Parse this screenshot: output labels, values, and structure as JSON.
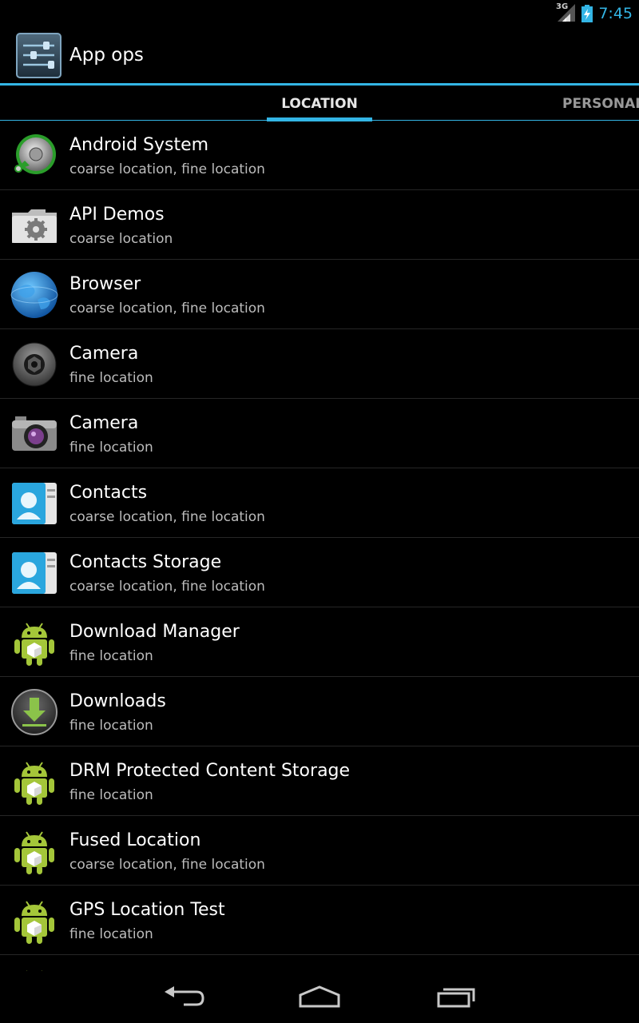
{
  "status_bar": {
    "network_label": "3G",
    "time": "7:45"
  },
  "action_bar": {
    "title": "App ops"
  },
  "tabs": [
    {
      "label": "LOCATION",
      "selected": true
    },
    {
      "label": "PERSONAL",
      "selected": false
    }
  ],
  "apps": [
    {
      "name": "Android System",
      "ops": "coarse location, fine location",
      "icon": "android-system-icon"
    },
    {
      "name": "API Demos",
      "ops": "coarse location",
      "icon": "folder-gear-icon"
    },
    {
      "name": "Browser",
      "ops": "coarse location, fine location",
      "icon": "globe-icon"
    },
    {
      "name": "Camera",
      "ops": "fine location",
      "icon": "camera-lens-icon"
    },
    {
      "name": "Camera",
      "ops": "fine location",
      "icon": "camera-icon"
    },
    {
      "name": "Contacts",
      "ops": "coarse location, fine location",
      "icon": "contacts-icon"
    },
    {
      "name": "Contacts Storage",
      "ops": "coarse location, fine location",
      "icon": "contacts-icon"
    },
    {
      "name": "Download Manager",
      "ops": "fine location",
      "icon": "android-robot-icon"
    },
    {
      "name": "Downloads",
      "ops": "fine location",
      "icon": "download-arrow-icon"
    },
    {
      "name": "DRM Protected Content Storage",
      "ops": "fine location",
      "icon": "android-robot-icon"
    },
    {
      "name": "Fused Location",
      "ops": "coarse location, fine location",
      "icon": "android-robot-icon"
    },
    {
      "name": "GPS Location Test",
      "ops": "fine location",
      "icon": "android-robot-icon"
    },
    {
      "name": "",
      "ops": "",
      "icon": "android-robot-icon"
    }
  ],
  "colors": {
    "accent": "#33b5e5",
    "background": "#000000",
    "secondary_text": "#bcbcbc",
    "android_green": "#a4c639"
  }
}
